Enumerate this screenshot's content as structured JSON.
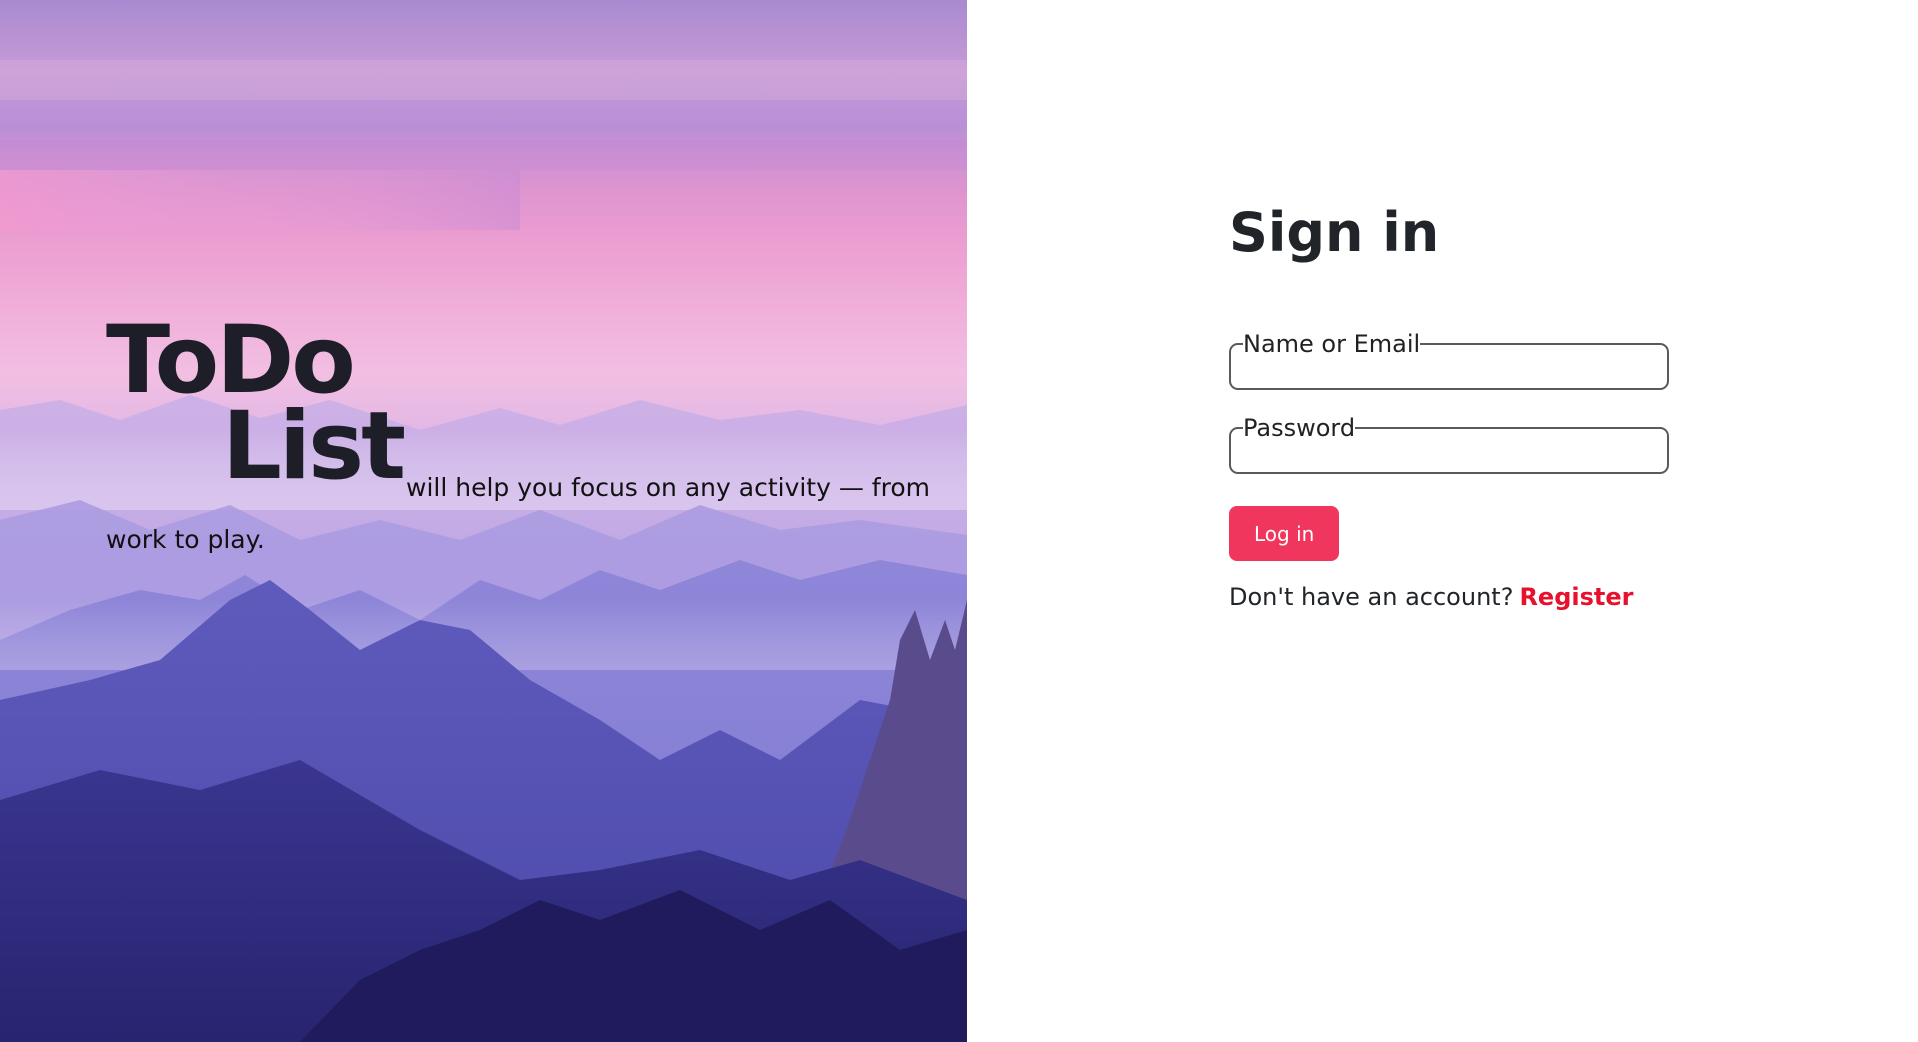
{
  "hero": {
    "title_line1": "ToDo",
    "title_line2": "List",
    "tagline": "will help you focus on any activity — from work to play."
  },
  "signin": {
    "title": "Sign in",
    "name_label": "Name or Email",
    "name_value": "",
    "password_label": "Password",
    "password_value": "",
    "login_label": "Log in",
    "register_prompt": "Don't have an account?",
    "register_label": "Register"
  },
  "colors": {
    "accent": "#f0365d",
    "link": "#e8112d"
  }
}
